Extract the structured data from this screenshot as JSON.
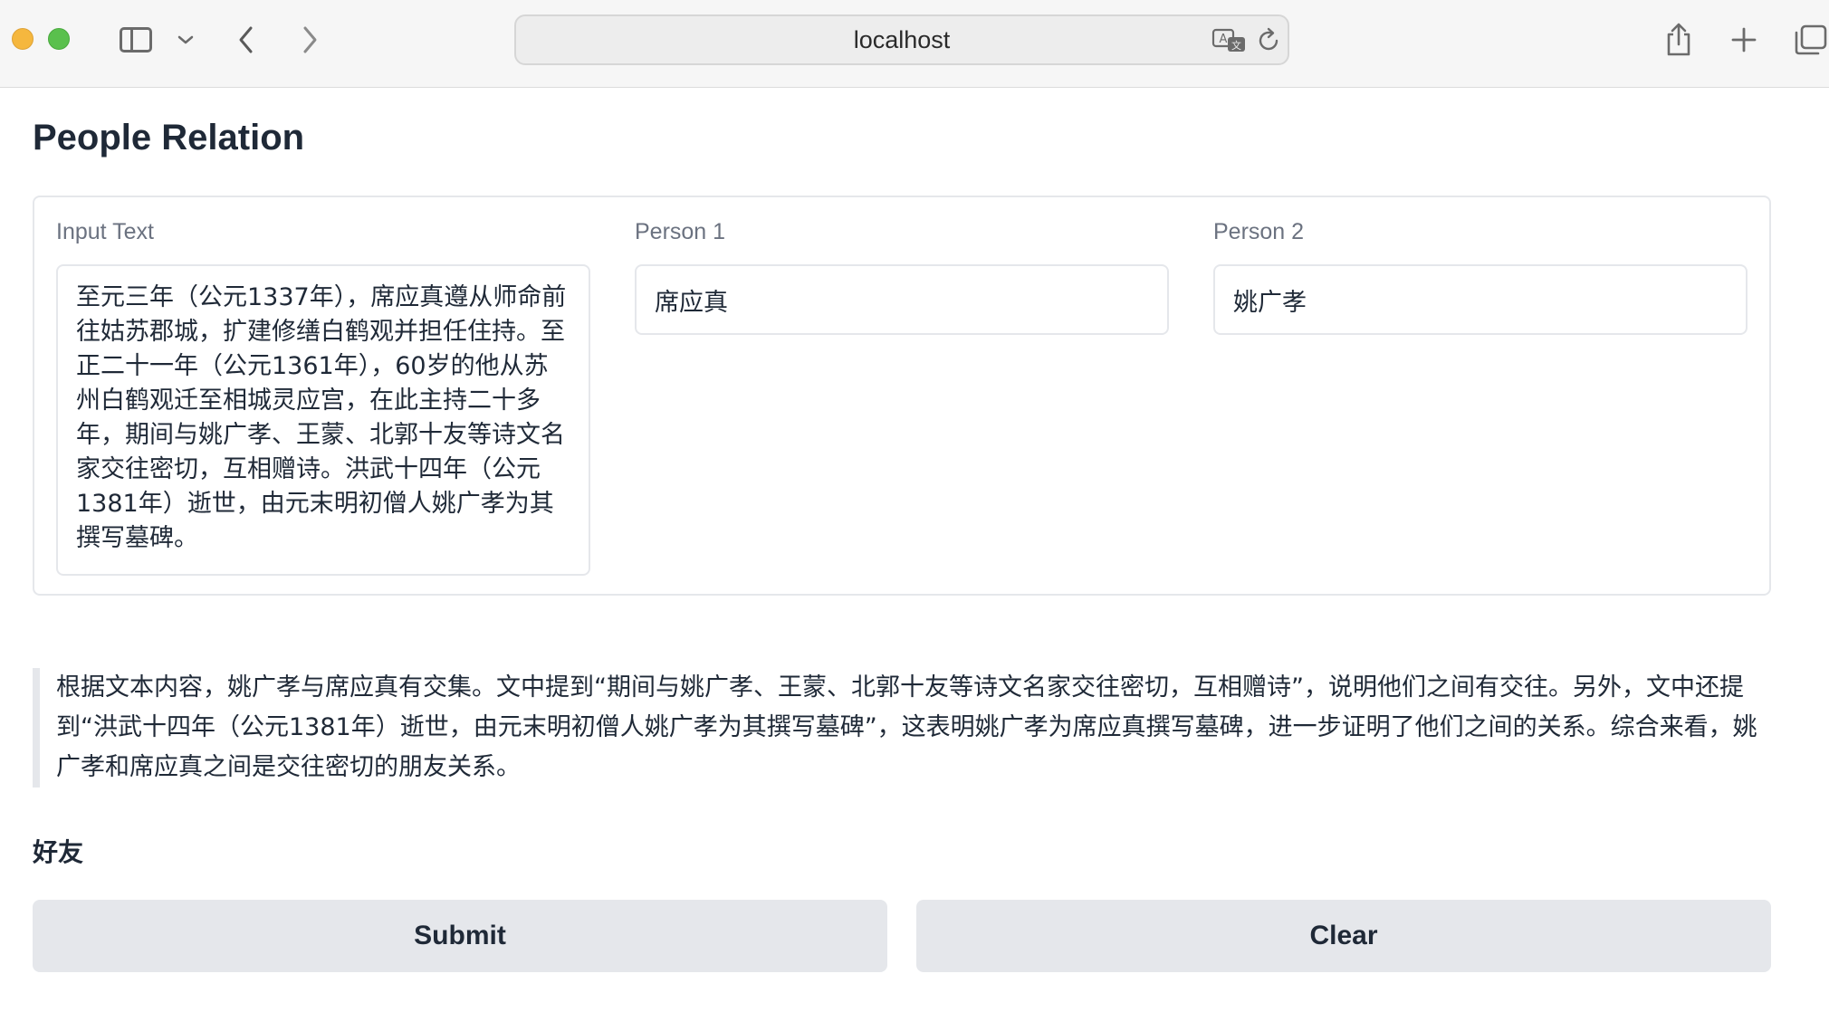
{
  "browser": {
    "url": "localhost",
    "icons": {
      "sidebar": "sidebar-icon",
      "dropdown": "chevron-down-icon",
      "back": "chevron-left-icon",
      "forward": "chevron-right-icon",
      "translate": "translate-icon",
      "reload": "reload-icon",
      "share": "share-icon",
      "new_tab": "plus-icon",
      "tabs": "tabs-overview-icon"
    }
  },
  "app": {
    "title": "People Relation",
    "inputs": {
      "text_label": "Input Text",
      "text_value": "至元三年（公元1337年），席应真遵从师命前往姑苏郡城，扩建修缮白鹤观并担任住持。至正二十一年（公元1361年），60岁的他从苏州白鹤观迁至相城灵应宫，在此主持二十多年，期间与姚广孝、王蒙、北郭十友等诗文名家交往密切，互相赠诗。洪武十四年（公元1381年）逝世，由元末明初僧人姚广孝为其撰写墓碑。",
      "person1_label": "Person 1",
      "person1_value": "席应真",
      "person2_label": "Person 2",
      "person2_value": "姚广孝"
    },
    "output": {
      "explanation": "根据文本内容，姚广孝与席应真有交集。文中提到“期间与姚广孝、王蒙、北郭十友等诗文名家交往密切，互相赠诗”，说明他们之间有交往。另外，文中还提到“洪武十四年（公元1381年）逝世，由元末明初僧人姚广孝为其撰写墓碑”，这表明姚广孝为席应真撰写墓碑，进一步证明了他们之间的关系。综合来看，姚广孝和席应真之间是交往密切的朋友关系。",
      "relation": "好友"
    },
    "buttons": {
      "submit": "Submit",
      "clear": "Clear"
    }
  }
}
